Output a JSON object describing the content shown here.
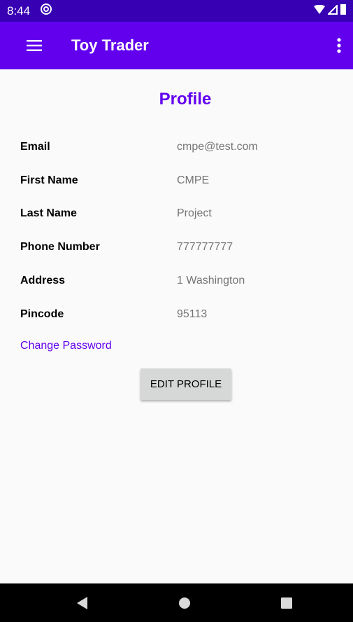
{
  "status_bar": {
    "time": "8:44"
  },
  "app_bar": {
    "title": "Toy Trader"
  },
  "profile": {
    "title": "Profile",
    "fields": [
      {
        "label": "Email",
        "value": "cmpe@test.com"
      },
      {
        "label": "First Name",
        "value": "CMPE"
      },
      {
        "label": "Last Name",
        "value": "Project"
      },
      {
        "label": "Phone Number",
        "value": "777777777"
      },
      {
        "label": "Address",
        "value": "1 Washington"
      },
      {
        "label": "Pincode",
        "value": "95113"
      }
    ],
    "change_password_label": "Change Password",
    "edit_button_label": "EDIT PROFILE"
  },
  "colors": {
    "status_bar": "#3700b3",
    "primary": "#6200ee",
    "button_bg": "#d6d7d7",
    "value_text": "#757575"
  }
}
